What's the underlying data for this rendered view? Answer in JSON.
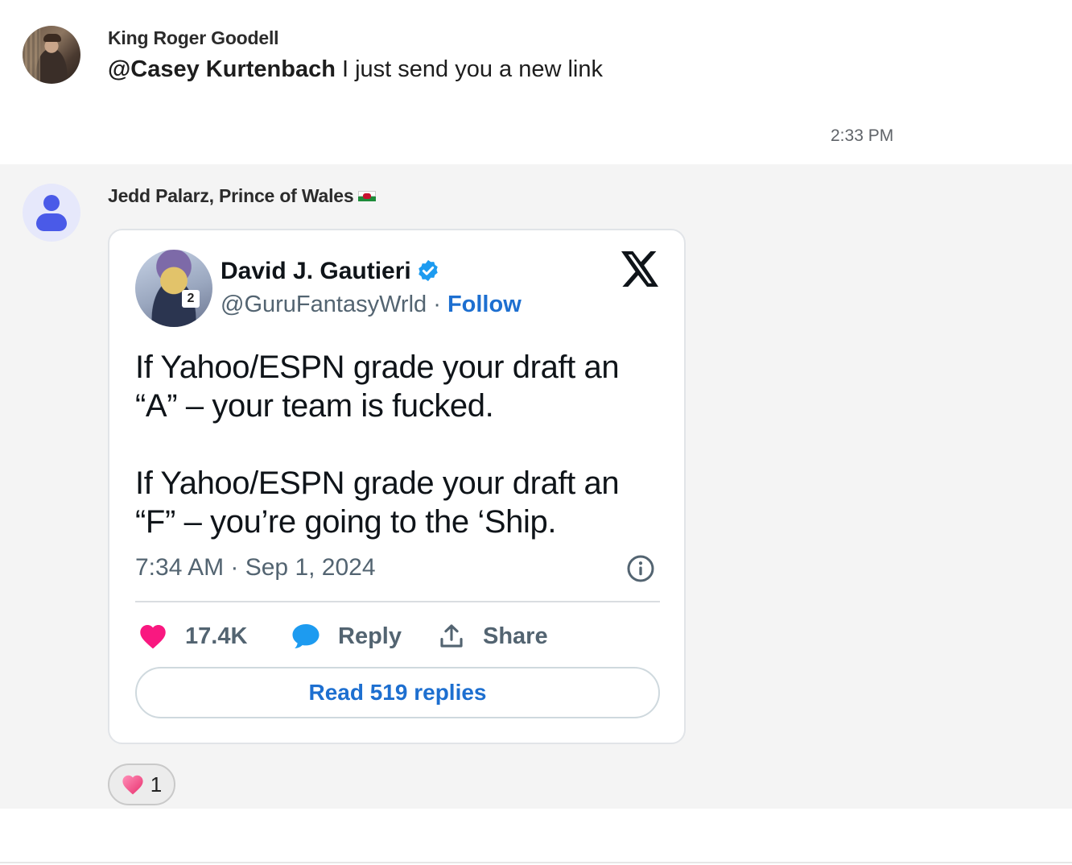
{
  "message1": {
    "sender": "King Roger Goodell",
    "mention": "@Casey Kurtenbach",
    "text": " I just send you a new link",
    "time": "2:33 PM"
  },
  "message2": {
    "sender": "Jedd Palarz, Prince of Wales",
    "sender_flag_icon": "wales-flag-icon",
    "tweet": {
      "author_name": "David J. Gautieri",
      "handle": "@GuruFantasyWrld",
      "separator": " · ",
      "follow_label": "Follow",
      "paragraph1": "If Yahoo/ESPN grade your draft an “A” – your team is fucked.",
      "paragraph2": "If Yahoo/ESPN grade your draft an “F” – you’re going to the ‘Ship.",
      "timestamp": "7:34 AM · Sep 1, 2024",
      "likes": "17.4K",
      "reply_label": "Reply",
      "share_label": "Share",
      "read_replies_label": "Read 519 replies",
      "avatar_badge": "2"
    },
    "reaction": {
      "emoji_icon": "pink-heart-icon",
      "count": "1"
    }
  },
  "colors": {
    "link_blue": "#1d6fd0",
    "like_pink": "#f91880",
    "reply_blue": "#1d9bf0",
    "verified_blue": "#1d9bf0"
  }
}
